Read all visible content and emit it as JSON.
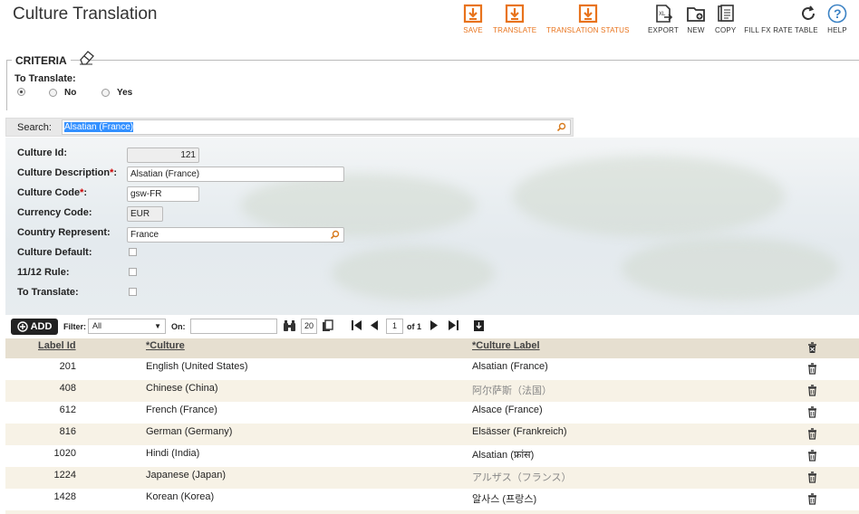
{
  "app": {
    "title": "Culture Translation"
  },
  "toolbar": {
    "save": "SAVE",
    "translate": "TRANSLATE",
    "translation_status": "TRANSLATION STATUS",
    "export": "EXPORT",
    "new": "NEW",
    "copy": "COPY",
    "fill_fx": "FILL FX RATE TABLE",
    "help": "HELP"
  },
  "criteria": {
    "legend": "CRITERIA",
    "to_translate_label": "To Translate:",
    "options": [
      "No",
      "Yes"
    ],
    "selected": "all"
  },
  "search": {
    "label": "Search:",
    "value": "Alsatian (France)"
  },
  "detail": {
    "culture_id_label": "Culture Id:",
    "culture_id": "121",
    "culture_description_label": "Culture Description",
    "culture_description": "Alsatian (France)",
    "culture_code_label": "Culture Code",
    "culture_code": "gsw-FR",
    "currency_code_label": "Currency Code:",
    "currency_code": "EUR",
    "country_represent_label": "Country Represent:",
    "country_represent": "France",
    "culture_default_label": "Culture Default:",
    "rule_label": "11/12 Rule:",
    "to_translate_label": "To Translate:",
    "required_mark": "*",
    "colon": ":"
  },
  "grid_toolbar": {
    "add": "ADD",
    "filter_label": "Filter:",
    "filter_value": "All",
    "on_label": "On:",
    "page_size": "20",
    "page": "1",
    "of": "of 1"
  },
  "grid": {
    "headers": {
      "label_id": "Label Id",
      "culture": "*Culture",
      "culture_label": "*Culture Label"
    },
    "rows": [
      {
        "id": "201",
        "culture": "English (United States)",
        "label": "Alsatian (France)"
      },
      {
        "id": "408",
        "culture": "Chinese (China)",
        "label": "阿尔萨斯（法国）"
      },
      {
        "id": "612",
        "culture": "French (France)",
        "label": "Alsace (France)"
      },
      {
        "id": "816",
        "culture": "German (Germany)",
        "label": "Elsässer (Frankreich)"
      },
      {
        "id": "1020",
        "culture": "Hindi (India)",
        "label": "Alsatian (फ्रांस)"
      },
      {
        "id": "1224",
        "culture": "Japanese (Japan)",
        "label": "アルザス（フランス）"
      },
      {
        "id": "1428",
        "culture": "Korean (Korea)",
        "label": "알사스 (프랑스)"
      }
    ]
  },
  "colors": {
    "accent": "#e8731c",
    "header_bg": "#e6dfd0",
    "row_alt": "#f7f2e6"
  }
}
